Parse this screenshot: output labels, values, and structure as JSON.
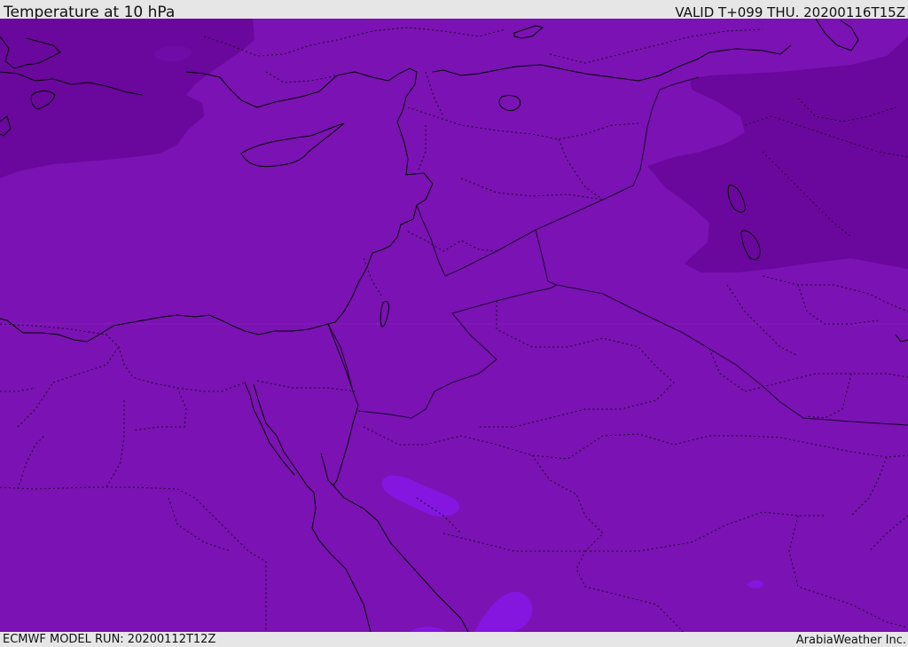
{
  "header": {
    "title": "Temperature at 10 hPa",
    "valid": "VALID T+099 THU. 20200116T15Z"
  },
  "footer": {
    "model_run": "ECMWF MODEL RUN: 20200112T12Z",
    "brand": "ArabiaWeather Inc."
  },
  "map": {
    "colors": {
      "base_field": "#7b12b3",
      "cold_field": "#6a079c",
      "warm_field": "#8416e0",
      "coastline": "#000000",
      "border": "#1a0030"
    }
  }
}
